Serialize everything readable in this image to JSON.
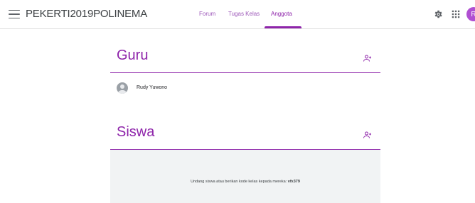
{
  "header": {
    "class_name": "PEKERTI2019POLINEMA",
    "avatar_initial": "R"
  },
  "tabs": [
    {
      "label": "Forum",
      "active": false
    },
    {
      "label": "Tugas Kelas",
      "active": false
    },
    {
      "label": "Anggota",
      "active": true
    }
  ],
  "teachers": {
    "title": "Guru",
    "members": [
      {
        "name": "Rudy Yuwono"
      }
    ]
  },
  "students": {
    "title": "Siswa",
    "invite_text": "Undang siswa atau berikan kode kelas kepada mereka:",
    "class_code": "vfx379"
  },
  "colors": {
    "accent": "#8e24aa",
    "avatar_bg": "#b04fd2",
    "invite_bg": "#f1f3f4"
  },
  "icons": {
    "menu": "hamburger-menu-icon",
    "settings": "gear-icon",
    "apps": "apps-grid-icon",
    "add_teacher": "add-person-icon",
    "add_student": "add-person-icon"
  }
}
